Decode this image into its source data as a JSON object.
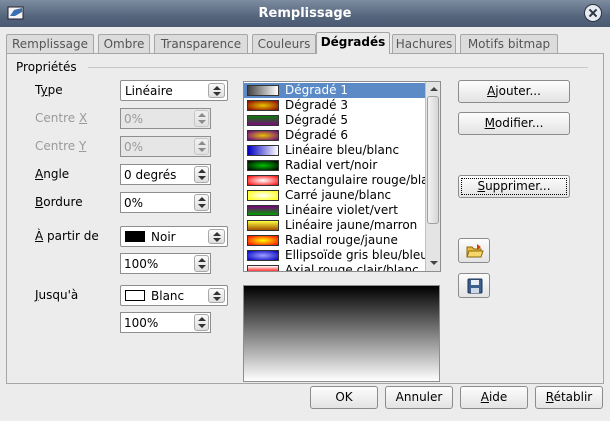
{
  "window": {
    "title": "Remplissage",
    "app_icon": "app-icon",
    "close_icon": "close-icon"
  },
  "tabs": [
    {
      "label": "Remplissage",
      "active": false
    },
    {
      "label": "Ombre",
      "active": false
    },
    {
      "label": "Transparence",
      "active": false
    },
    {
      "label": "Couleurs",
      "active": false
    },
    {
      "label": "Dégradés",
      "active": true
    },
    {
      "label": "Hachures",
      "active": false
    },
    {
      "label": "Motifs bitmap",
      "active": false
    }
  ],
  "properties": {
    "section_label": "Propriétés",
    "type": {
      "label_pre": "T",
      "label_u": "y",
      "label_post": "pe",
      "value": "Linéaire"
    },
    "centre_x": {
      "label_pre": "Centre ",
      "label_u": "X",
      "value": "0%"
    },
    "centre_y": {
      "label_pre": "Centre ",
      "label_u": "Y",
      "value": "0%"
    },
    "angle": {
      "label_u": "A",
      "label_post": "ngle",
      "value": "0 degrés"
    },
    "bordure": {
      "label_u": "B",
      "label_post": "ordure",
      "value": "0%"
    },
    "from": {
      "label_u": "À",
      "label_post": " partir de",
      "color_name": "Noir",
      "color_hex": "#000000",
      "intensity": "100%"
    },
    "to": {
      "label_u": "J",
      "label_post": "usqu'à",
      "color_name": "Blanc",
      "color_hex": "#ffffff",
      "intensity": "100%"
    }
  },
  "gradient_list": {
    "items": [
      {
        "name": "Dégradé 1",
        "selected": true,
        "thumb": "linear-gradient(90deg,#444,#fff)"
      },
      {
        "name": "Dégradé 3",
        "selected": false,
        "thumb": "radial-gradient(#e8c400,#8a0000)"
      },
      {
        "name": "Dégradé 5",
        "selected": false,
        "thumb": "linear-gradient(#0a7a0a,#7a0a7a)"
      },
      {
        "name": "Dégradé 6",
        "selected": false,
        "thumb": "radial-gradient(#e8c000,#6a008a)"
      },
      {
        "name": "Linéaire bleu/blanc",
        "selected": false,
        "thumb": "linear-gradient(90deg,#0000c0,#ffffff)"
      },
      {
        "name": "Radial vert/noir",
        "selected": false,
        "thumb": "radial-gradient(#00c000,#000)"
      },
      {
        "name": "Rectangulaire rouge/blanc",
        "selected": false,
        "thumb": "radial-gradient(#fff,#f00)"
      },
      {
        "name": "Carré jaune/blanc",
        "selected": false,
        "thumb": "radial-gradient(#fff,#ffff00)"
      },
      {
        "name": "Linéaire violet/vert",
        "selected": false,
        "thumb": "linear-gradient(#7a007a,#00a000)"
      },
      {
        "name": "Linéaire jaune/marron",
        "selected": false,
        "thumb": "linear-gradient(#ffff40,#a05000)"
      },
      {
        "name": "Radial rouge/jaune",
        "selected": false,
        "thumb": "radial-gradient(#ffff00,#ff0000)"
      },
      {
        "name": "Ellipsoïde gris bleu/bleu",
        "selected": false,
        "thumb": "radial-gradient(#a0a0ff,#0000c0)"
      },
      {
        "name": "Axial rouge clair/blanc",
        "selected": false,
        "thumb": "linear-gradient(#fff,#ff4040,#fff)"
      }
    ]
  },
  "side_buttons": {
    "add": {
      "label_u": "A",
      "label_post": "jouter..."
    },
    "modify": {
      "label_u": "M",
      "label_post": "odifier..."
    },
    "delete": {
      "label_u": "S",
      "label_post": "upprimer..."
    },
    "load_icon": "folder-open-icon",
    "save_icon": "floppy-disk-icon"
  },
  "footer": {
    "ok": "OK",
    "cancel": "Annuler",
    "help_u": "A",
    "help_post": "ide",
    "reset_u": "R",
    "reset_post": "établir"
  }
}
